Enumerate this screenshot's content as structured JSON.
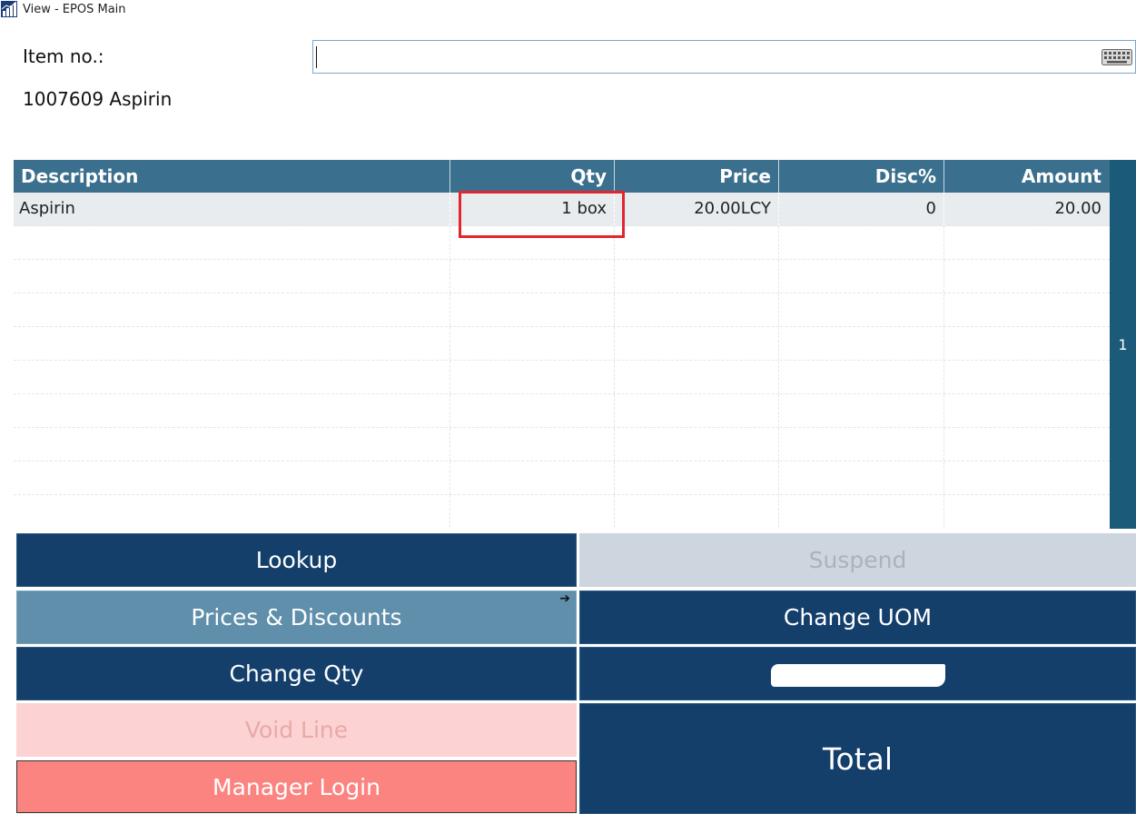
{
  "window": {
    "title": "View - EPOS Main"
  },
  "item": {
    "label": "Item no.:",
    "input_value": "",
    "input_placeholder": "",
    "description": "1007609 Aspirin"
  },
  "grid": {
    "columns": [
      "Description",
      "Qty",
      "Price",
      "Disc%",
      "Amount"
    ],
    "rows": [
      {
        "description": "Aspirin",
        "qty": "1 box",
        "price": "20.00LCY",
        "disc": "0",
        "amount": "20.00"
      }
    ],
    "empty_rows": 9,
    "page": "1"
  },
  "buttons": {
    "lookup": "Lookup",
    "suspend": "Suspend",
    "prices_discounts": "Prices & Discounts",
    "prices_arrow": "➔",
    "change_uom": "Change UOM",
    "change_qty": "Change Qty",
    "redacted": "",
    "void_line": "Void Line",
    "manager_login": "Manager Login",
    "total": "Total"
  },
  "colors": {
    "header_bg": "#3b6f8e",
    "button_dark": "#143f6b",
    "button_prices": "#5f8faa",
    "button_disabled": "#cdd5de",
    "button_void": "#fcd3d2",
    "button_manager": "#fb8480",
    "highlight": "#e3262e"
  },
  "icons": {
    "app": "chart-bar-icon",
    "keyboard": "keyboard-icon"
  }
}
